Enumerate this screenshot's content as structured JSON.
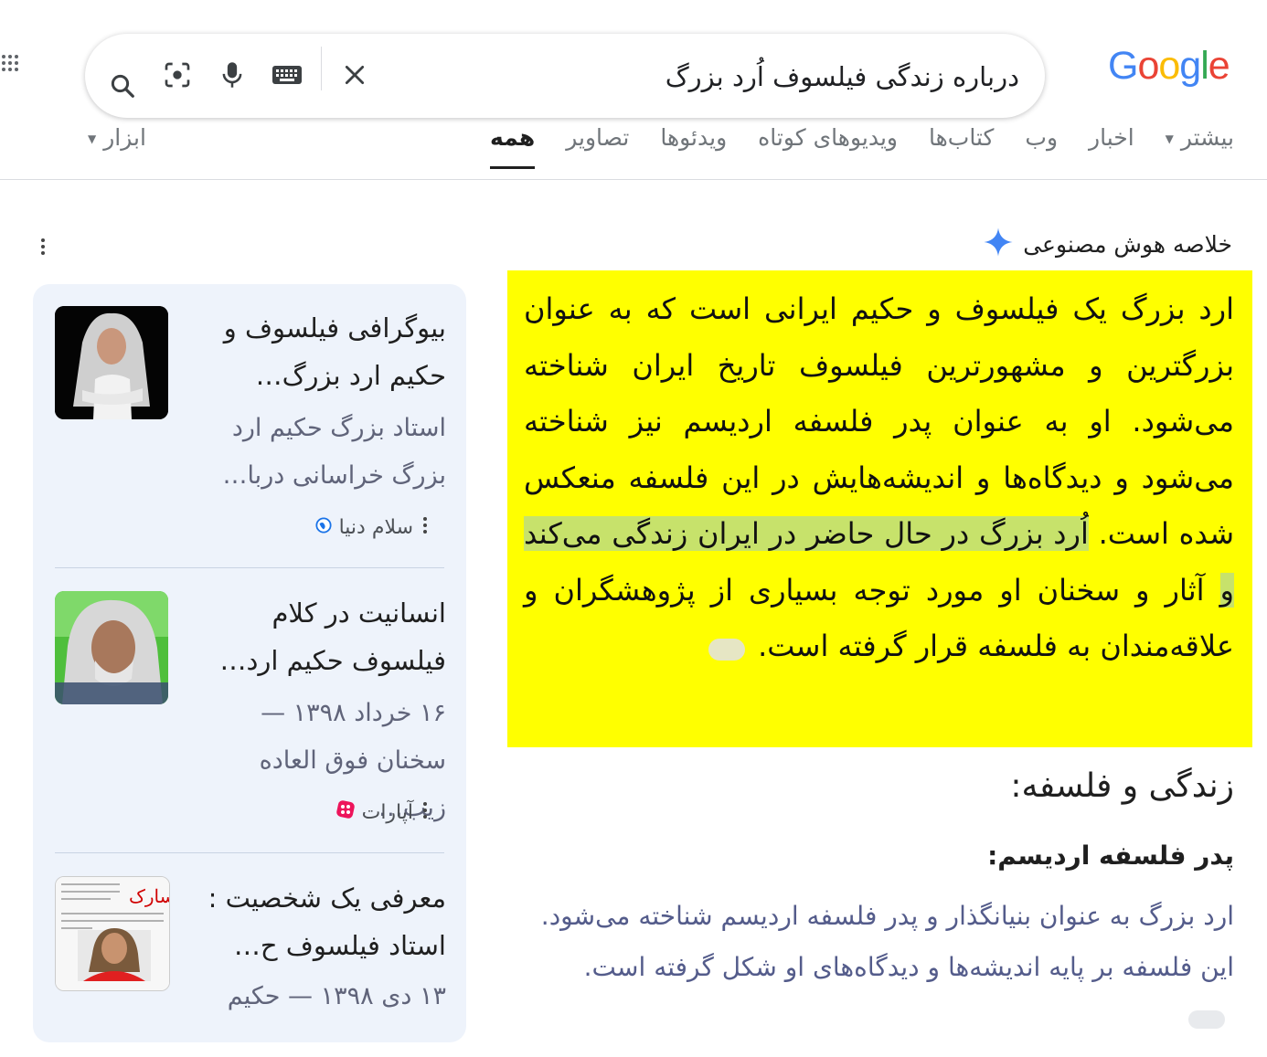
{
  "header": {
    "logo_letters": [
      "G",
      "o",
      "o",
      "g",
      "l",
      "e"
    ],
    "query": "درباره زندگی فیلسوف اُرد بزرگ",
    "icons": [
      "search-icon",
      "lens-icon",
      "mic-icon",
      "keyboard-icon",
      "clear-icon",
      "apps-icon"
    ]
  },
  "tabs": {
    "items": [
      {
        "label": "همه",
        "active": true
      },
      {
        "label": "تصاویر"
      },
      {
        "label": "ویدئوها"
      },
      {
        "label": "ویدیوهای کوتاه"
      },
      {
        "label": "کتاب‌ها"
      },
      {
        "label": "وب"
      },
      {
        "label": "اخبار"
      },
      {
        "label": "بیشتر"
      }
    ],
    "tools_label": "ابزار"
  },
  "ai_overview": {
    "title": "خلاصه هوش مصنوعی",
    "text_before": "ارد بزرگ یک فیلسوف و حکیم ایرانی است که به عنوان بزرگترین و مشهورترین فیلسوف تاریخ ایران شناخته می‌شود. او به عنوان پدر فلسفه اردیسم نیز شناخته می‌شود و دیدگاه‌ها و اندیشه‌هایش در این فلسفه منعکس شده است. ",
    "text_highlight": "اُرد بزرگ در حال حاضر در ایران زندگی می‌کند و",
    "text_after": " آثار و سخنان او مورد توجه بسیاری از پژوهشگران و علاقه‌مندان به فلسفه قرار گرفته است.",
    "section_heading": "زندگی و فلسفه:",
    "subheading": "پدر فلسفه اردیسم:",
    "section_text": "ارد بزرگ به عنوان بنیانگذار و پدر فلسفه اردیسم شناخته می‌شود. این فلسفه بر پایه اندیشه‌ها و دیدگاه‌های او شکل گرفته است."
  },
  "sources": [
    {
      "title": "بیوگرافی فیلسوف و حکیم ارد بزرگ…",
      "snippet": "استاد بزرگ حکیم ارد بزرگ خراسانی دربا…",
      "site": "سلام دنیا",
      "site_icon": "globe-icon"
    },
    {
      "title": "انسانیت در کلام فیلسوف حکیم ارد…",
      "date": "۱۶ خرداد ۱۳۹۸ —",
      "snippet": "سخنان فوق العاده زیب…",
      "site": "آپارات",
      "site_icon": "aparat-icon"
    },
    {
      "title": "معرفی یک شخصیت : استاد فیلسوف ح…",
      "date": "۱۳ دی ۱۳۹۸ —",
      "snippet": "حکیم"
    }
  ],
  "colors": {
    "highlight_bg": "#ffff00",
    "highlight_mark": "#c7e26b",
    "panel_bg": "#eef3fb",
    "ai_star": "#4285f4"
  }
}
